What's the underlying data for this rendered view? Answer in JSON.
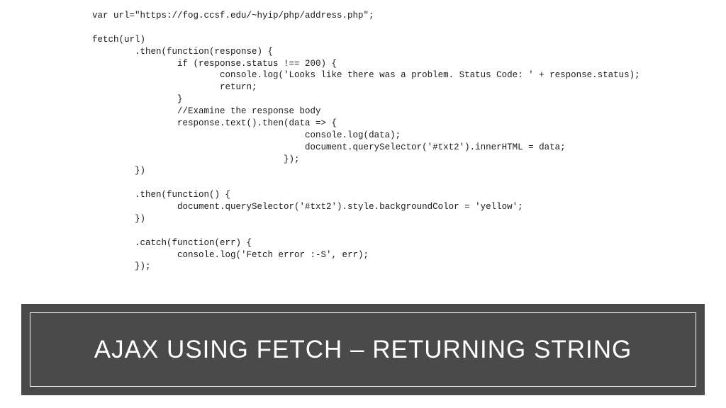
{
  "code": "var url=\"https://fog.ccsf.edu/~hyip/php/address.php\";\n\nfetch(url)\n        .then(function(response) {\n                if (response.status !== 200) {\n                        console.log('Looks like there was a problem. Status Code: ' + response.status);\n                        return;\n                }\n                //Examine the response body\n                response.text().then(data => {\n                                        console.log(data);\n                                        document.querySelector('#txt2').innerHTML = data;\n                                    });\n        })\n\n        .then(function() {\n                document.querySelector('#txt2').style.backgroundColor = 'yellow';\n        })\n\n        .catch(function(err) {\n                console.log('Fetch error :-S', err);\n        });",
  "title": "AJAX USING FETCH – RETURNING STRING"
}
